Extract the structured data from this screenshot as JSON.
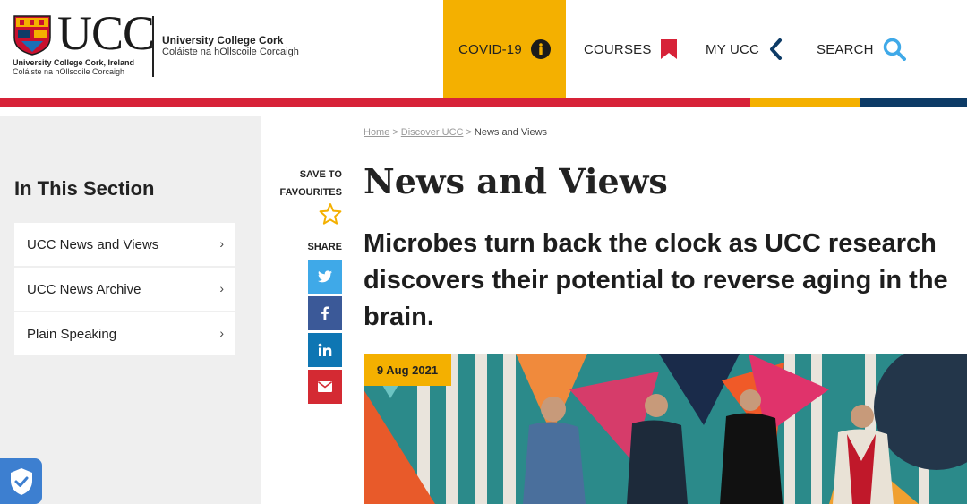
{
  "logo": {
    "wordmark": "UCC",
    "sub_line1": "University College Cork, Ireland",
    "sub_line2": "Coláiste na hOllscoile Corcaigh",
    "name_line1": "University College Cork",
    "name_line2": "Coláiste na hOllscoile Corcaigh"
  },
  "nav": {
    "covid": "COVID-19",
    "courses": "COURSES",
    "myucc": "MY UCC",
    "search": "SEARCH"
  },
  "colors": {
    "accent_yellow": "#f4b000",
    "stripe_red": "#d72238",
    "stripe_navy": "#0d3b66",
    "twitter": "#3fa9e8",
    "facebook": "#3b5998",
    "linkedin": "#0e76b3",
    "email": "#d42a33"
  },
  "sidebar": {
    "title": "In This Section",
    "items": [
      {
        "label": "UCC News and Views"
      },
      {
        "label": "UCC News Archive"
      },
      {
        "label": "Plain Speaking"
      }
    ]
  },
  "share": {
    "save_line1": "SAVE TO",
    "save_line2": "FAVOURITES",
    "share_label": "SHARE"
  },
  "breadcrumb": {
    "home": "Home",
    "discover": "Discover UCC",
    "current": "News and Views"
  },
  "main": {
    "page_title": "News and Views",
    "headline": "Microbes turn back the clock as UCC research discovers their potential to reverse aging in the brain.",
    "date": "9 Aug 2021"
  }
}
